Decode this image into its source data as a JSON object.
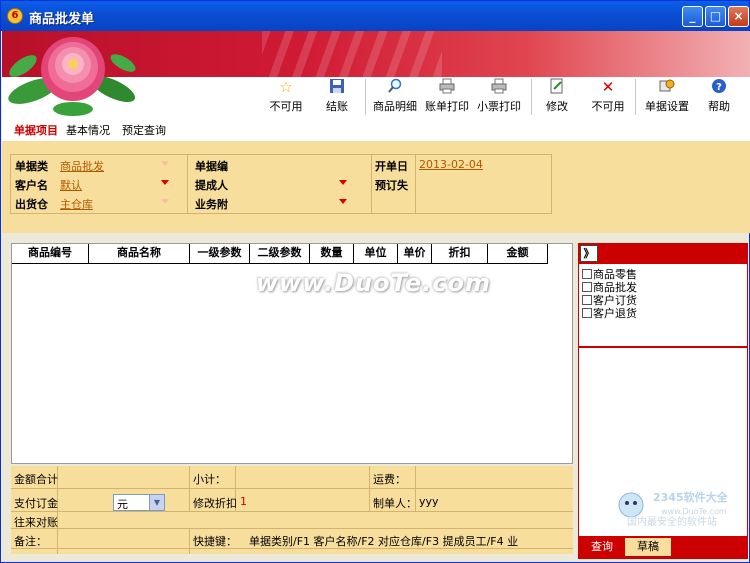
{
  "window": {
    "title": "商品批发单",
    "app_icon": "6",
    "min": "_",
    "max": "□",
    "close": "×"
  },
  "toolbar": [
    {
      "id": "disabled1",
      "label": "不可用",
      "icon": "star-icon"
    },
    {
      "id": "settle",
      "label": "结账",
      "icon": "save-icon"
    },
    {
      "id": "detail",
      "label": "商品明细",
      "icon": "magnifier-icon"
    },
    {
      "id": "bill_print",
      "label": "账单打印",
      "icon": "printer-icon"
    },
    {
      "id": "ticket_print",
      "label": "小票打印",
      "icon": "printer-icon"
    },
    {
      "id": "modify",
      "label": "修改",
      "icon": "edit-icon"
    },
    {
      "id": "disabled2",
      "label": "不可用",
      "icon": "red-x-icon"
    },
    {
      "id": "settings",
      "label": "单据设置",
      "icon": "settings-icon"
    },
    {
      "id": "help",
      "label": "帮助",
      "icon": "help-icon"
    }
  ],
  "tabs": [
    "单据项目",
    "基本情况",
    "预定查询"
  ],
  "form": {
    "doc_type_label": "单据类",
    "doc_type": "商品批发",
    "customer_label": "客户名",
    "customer": "默认",
    "warehouse_label": "出货仓",
    "warehouse": "主仓库",
    "doc_no_label": "单据编",
    "proposer_label": "提成人",
    "business_label": "业务附",
    "open_date_label": "开单日",
    "open_date": "2013-02-04",
    "reserve_label": "预订失"
  },
  "grid": {
    "columns": [
      "商品编号",
      "商品名称",
      "一级参数",
      "二级参数",
      "数量",
      "单位",
      "单价",
      "折扣",
      "金额"
    ]
  },
  "watermark": "www.DuoTe.com",
  "side": {
    "toggle": "》",
    "items": [
      "商品零售",
      "商品批发",
      "客户订货",
      "客户退货"
    ],
    "tabs": [
      "查询",
      "草稿"
    ]
  },
  "bottom": {
    "total_label": "金额合计",
    "subtotal_label": "小计：",
    "freight_label": "运费：",
    "pay_label": "支付订金",
    "currency": "元",
    "discount_label": "修改折扣",
    "discount": "1",
    "maker_label": "制单人：",
    "maker": "yyy",
    "account_label": "往来对账",
    "remark_label": "备注：",
    "shortcut_label": "快捷键：",
    "shortcuts": "单据类别/F1  客户名称/F2  对应仓库/F3  提成员工/F4  业"
  },
  "logo": {
    "brand": "2345软件大全",
    "site": "www.DuoTe.com",
    "tagline": "国内最安全的软件站"
  }
}
